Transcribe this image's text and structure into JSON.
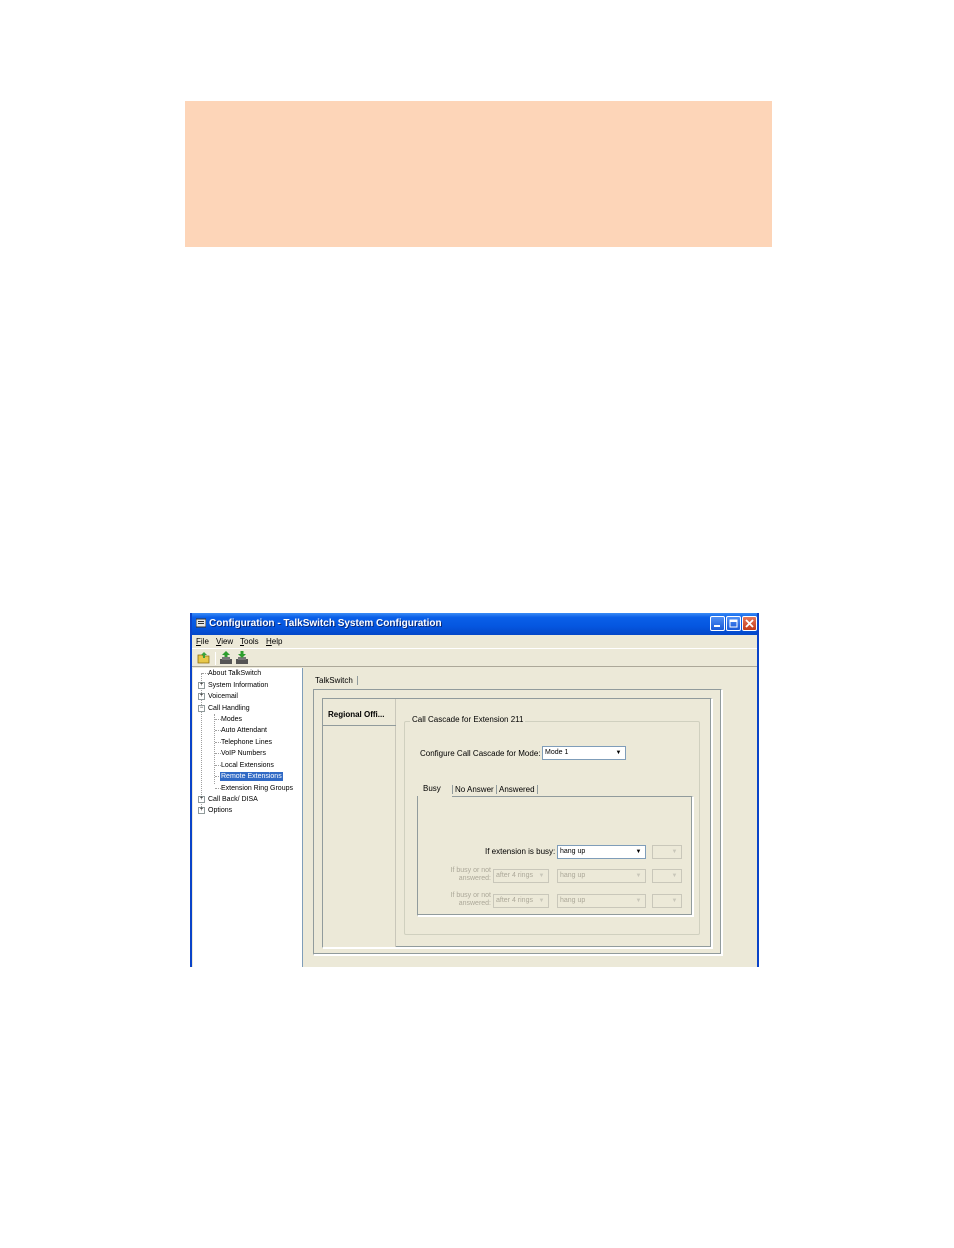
{
  "window": {
    "title": "Configuration - TalkSwitch System Configuration"
  },
  "menu": [
    "File",
    "View",
    "Tools",
    "Help"
  ],
  "toolbar": {
    "icons": [
      "open-icon",
      "upload-icon",
      "download-icon"
    ]
  },
  "tree": {
    "items": [
      {
        "label": "About TalkSwitch",
        "expander": ""
      },
      {
        "label": "System Information",
        "expander": "+"
      },
      {
        "label": "Voicemail",
        "expander": "+"
      },
      {
        "label": "Call Handling",
        "expander": "−"
      },
      {
        "label": "Modes",
        "expander": ""
      },
      {
        "label": "Auto Attendant",
        "expander": ""
      },
      {
        "label": "Telephone Lines",
        "expander": ""
      },
      {
        "label": "VoIP Numbers",
        "expander": ""
      },
      {
        "label": "Local Extensions",
        "expander": ""
      },
      {
        "label": "Remote Extensions",
        "expander": "",
        "selected": true
      },
      {
        "label": "Extension Ring Groups",
        "expander": ""
      },
      {
        "label": "Call Back/ DISA",
        "expander": "+"
      },
      {
        "label": "Options",
        "expander": "+"
      }
    ]
  },
  "main": {
    "outer_tab": "TalkSwitch",
    "sidebar_item": "Regional Offi...",
    "group_title": "Call Cascade for Extension 211",
    "mode_label": "Configure Call Cascade for Mode:",
    "mode_value": "Mode 1",
    "inner_tabs": [
      "Busy",
      "No Answer",
      "Answered"
    ],
    "busy_label": "If extension is busy:",
    "busy_action": "hang up",
    "row2_label": "If busy or not answered:",
    "row2_rings": "after 4 rings",
    "row2_action": "hang up",
    "row3_label": "If busy or not answered:",
    "row3_rings": "after 4 rings",
    "row3_action": "hang up"
  },
  "colors": {
    "banner": "#fdd5b8",
    "titlebar": "#0556e0",
    "window_bg": "#ece9d8",
    "selection": "#316ac5"
  }
}
